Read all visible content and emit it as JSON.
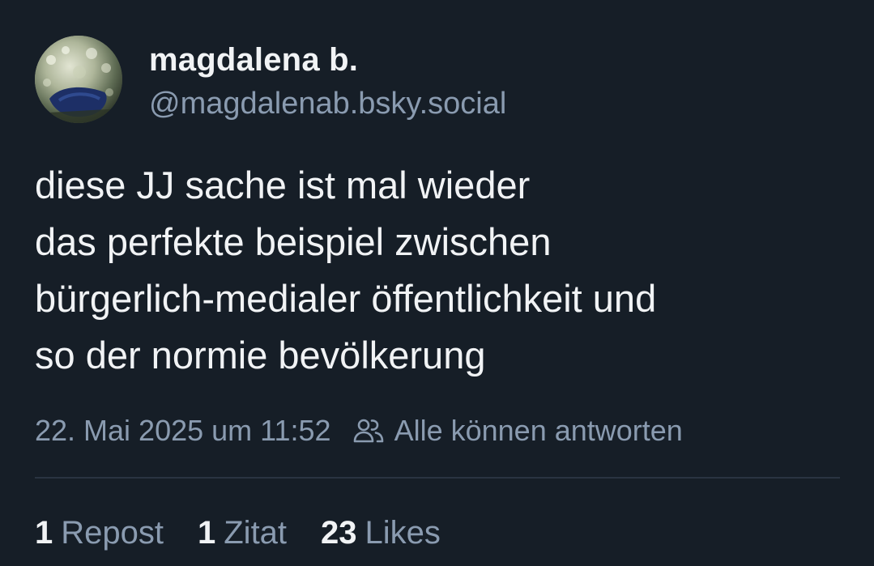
{
  "author": {
    "display_name": "magdalena b.",
    "handle": "@magdalenab.bsky.social"
  },
  "post": {
    "text": "diese JJ sache ist mal wieder\ndas perfekte beispiel zwischen\nbürgerlich-medialer öffentlichkeit und\nso der normie bevölkerung"
  },
  "meta": {
    "timestamp": "22. Mai 2025 um 11:52",
    "reply_setting": "Alle können antworten",
    "reply_icon": "people-icon"
  },
  "stats": {
    "reposts_count": "1",
    "reposts_label": "Repost",
    "quotes_count": "1",
    "quotes_label": "Zitat",
    "likes_count": "23",
    "likes_label": "Likes"
  },
  "colors": {
    "background": "#161e27",
    "primary_text": "#f1f3f5",
    "secondary_text": "#8a9bb0",
    "divider": "#2a3441"
  }
}
